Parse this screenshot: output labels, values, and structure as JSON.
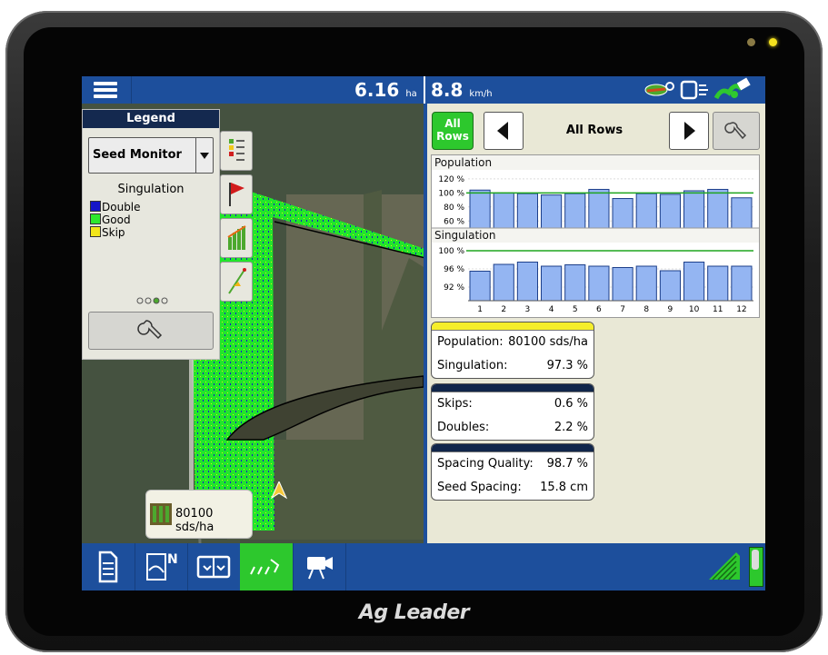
{
  "top_bar": {
    "area_value": "6.16",
    "area_unit": "ha",
    "speed_value": "8.8",
    "speed_unit": "km/h"
  },
  "legend": {
    "title": "Legend",
    "mode_select": "Seed Monitor",
    "subtitle": "Singulation",
    "items": [
      {
        "label": "Double",
        "color": "#1515c8"
      },
      {
        "label": "Good",
        "color": "#2ee82e"
      },
      {
        "label": "Skip",
        "color": "#f2e61a"
      }
    ]
  },
  "map_badge": {
    "value": "80100 sds/ha"
  },
  "row_selector": {
    "all_button": "All\nRows",
    "current": "All Rows"
  },
  "chart_data": [
    {
      "type": "bar",
      "title": "Population",
      "ytick_labels": [
        "120 %",
        "100 %",
        "80 %",
        "60 %"
      ],
      "ylim": [
        50,
        125
      ],
      "target": 100,
      "categories": [
        "1",
        "2",
        "3",
        "4",
        "5",
        "6",
        "7",
        "8",
        "9",
        "10",
        "11",
        "12"
      ],
      "values": [
        104,
        100,
        99,
        97,
        99,
        105,
        92,
        99,
        98,
        103,
        105,
        93
      ]
    },
    {
      "type": "bar",
      "title": "Singulation",
      "ytick_labels": [
        "100 %",
        "96 %",
        "92 %"
      ],
      "ylim": [
        89,
        101
      ],
      "target": 100,
      "categories": [
        "1",
        "2",
        "3",
        "4",
        "5",
        "6",
        "7",
        "8",
        "9",
        "10",
        "11",
        "12"
      ],
      "values": [
        95.5,
        97.0,
        97.5,
        96.6,
        96.9,
        96.6,
        96.3,
        96.6,
        95.6,
        97.5,
        96.6,
        96.6
      ]
    }
  ],
  "cards": [
    {
      "color": "#f5ee2a",
      "rows": [
        {
          "label": "Population:",
          "value": "80100 sds/ha"
        },
        {
          "label": "Singulation:",
          "value": "97.3 %"
        }
      ]
    },
    {
      "color": "#11264a",
      "rows": [
        {
          "label": "Skips:",
          "value": "0.6 %"
        },
        {
          "label": "Doubles:",
          "value": "2.2 %"
        }
      ]
    },
    {
      "color": "#11264a",
      "rows": [
        {
          "label": "Spacing Quality:",
          "value": "98.7 %"
        },
        {
          "label": "Seed Spacing:",
          "value": "15.8 cm"
        }
      ]
    }
  ],
  "brand": "Ag Leader",
  "colors": {
    "bar_fill": "#94b5f2",
    "bar_stroke": "#1d3f8a",
    "target_line": "#1ea51e",
    "accent_green": "#2dc82d",
    "header_blue": "#1d4f9c"
  }
}
